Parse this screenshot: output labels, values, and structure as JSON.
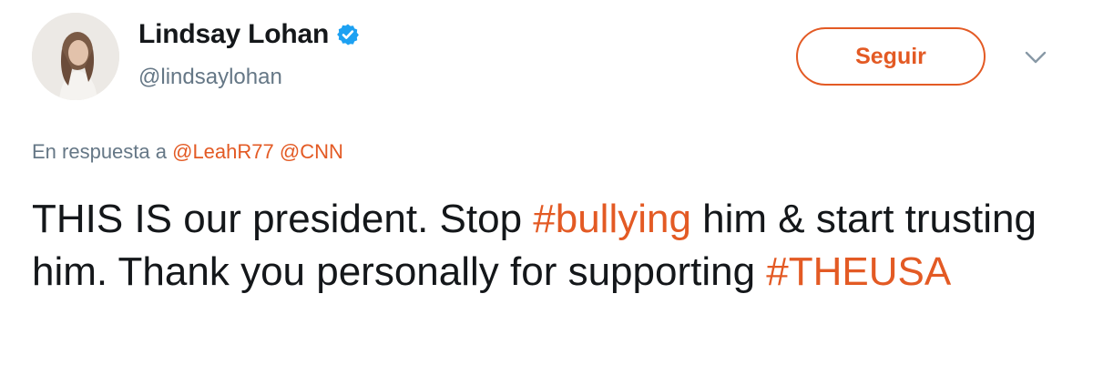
{
  "author": {
    "display_name": "Lindsay Lohan",
    "handle": "@lindsaylohan",
    "verified": true
  },
  "follow_button": {
    "label": "Seguir"
  },
  "reply_context": {
    "prefix": "En respuesta a",
    "mentions": [
      "@LeahR77",
      "@CNN"
    ]
  },
  "tweet": {
    "segments": [
      {
        "text": "THIS IS our president. Stop ",
        "type": "text"
      },
      {
        "text": "#bullying",
        "type": "hashtag"
      },
      {
        "text": " him & start trusting him. Thank you personally for supporting ",
        "type": "text"
      },
      {
        "text": "#THEUSA",
        "type": "hashtag"
      }
    ]
  },
  "colors": {
    "accent": "#e35a24",
    "verified_badge": "#1da1f2",
    "secondary_text": "#657786",
    "primary_text": "#14171a"
  },
  "icons": {
    "verified": "verified-badge-icon",
    "more": "chevron-down-icon"
  }
}
